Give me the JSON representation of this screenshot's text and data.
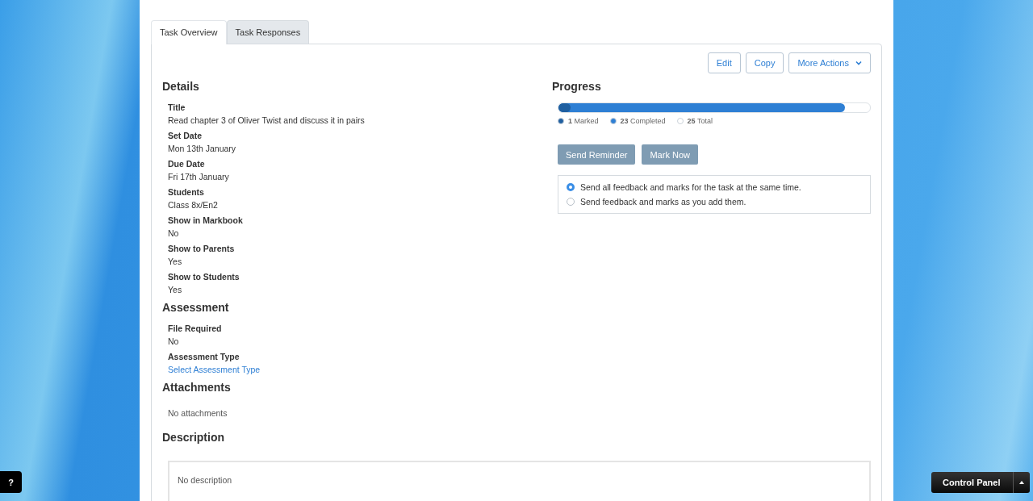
{
  "tabs": [
    {
      "label": "Task Overview",
      "selected": true
    },
    {
      "label": "Task Responses",
      "selected": false
    }
  ],
  "actions": [
    {
      "label": "Edit",
      "kind": "plain"
    },
    {
      "label": "Copy",
      "kind": "plain"
    },
    {
      "label": "More Actions",
      "kind": "dropdown"
    }
  ],
  "details": {
    "heading": "Details",
    "fields": [
      {
        "label": "Title",
        "value": "Read chapter 3 of Oliver Twist and discuss it in pairs"
      },
      {
        "label": "Set Date",
        "value": "Mon 13th January"
      },
      {
        "label": "Due Date",
        "value": "Fri 17th January"
      },
      {
        "label": "Students",
        "value": "Class 8x/En2"
      },
      {
        "label": "Show in Markbook",
        "value": "No"
      },
      {
        "label": "Show to Parents",
        "value": "Yes"
      },
      {
        "label": "Show to Students",
        "value": "Yes"
      }
    ]
  },
  "assessment": {
    "heading": "Assessment",
    "fields": [
      {
        "label": "File Required",
        "value": "No",
        "kind": "text"
      },
      {
        "label": "Assessment Type",
        "value": "Select Assessment Type",
        "kind": "link"
      }
    ]
  },
  "attachments": {
    "heading": "Attachments",
    "text": "No attachments"
  },
  "description": {
    "heading": "Description",
    "text": "No description"
  },
  "progress": {
    "heading": "Progress",
    "segments": [
      {
        "count": "1",
        "label": "Marked",
        "level": 0.04,
        "color": "#1f5fa0"
      },
      {
        "count": "23",
        "label": "Completed",
        "level": 0.92,
        "color": "#2e7fd4"
      },
      {
        "count": "25",
        "label": "Total",
        "color": "#ffffff"
      }
    ],
    "buttons": [
      "Send Reminder",
      "Mark Now"
    ],
    "options": [
      {
        "label": "Send all feedback and marks for the task at the same time.",
        "selected": true
      },
      {
        "label": "Send feedback and marks as you add them.",
        "selected": false
      }
    ]
  },
  "help_button": "?",
  "control_panel": {
    "label": "Control Panel"
  }
}
